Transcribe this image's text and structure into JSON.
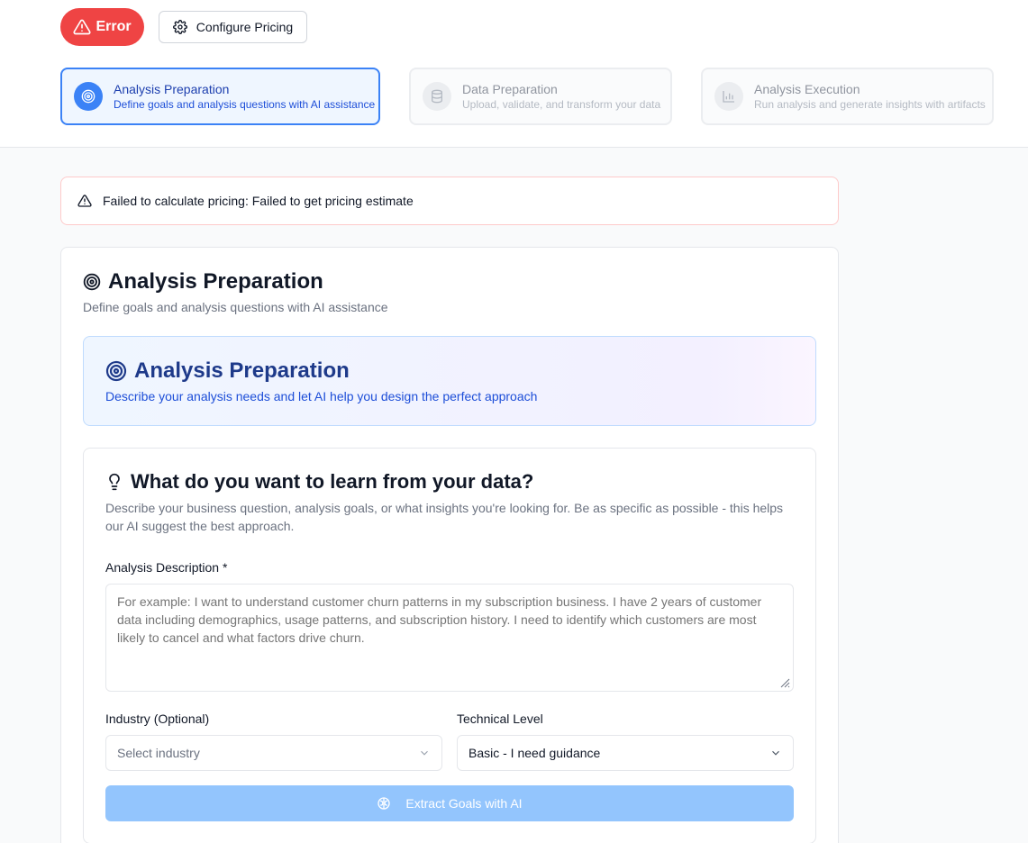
{
  "header": {
    "error_label": "Error",
    "configure_label": "Configure Pricing",
    "steps": [
      {
        "title": "Analysis Preparation",
        "subtitle": "Define goals and analysis questions with AI assistance",
        "state": "active"
      },
      {
        "title": "Data Preparation",
        "subtitle": "Upload, validate, and transform your data",
        "state": "inactive"
      },
      {
        "title": "Analysis Execution",
        "subtitle": "Run analysis and generate insights with artifacts",
        "state": "inactive"
      }
    ]
  },
  "alert": {
    "message": "Failed to calculate pricing: Failed to get pricing estimate"
  },
  "card": {
    "title": "Analysis Preparation",
    "subtitle": "Define goals and analysis questions with AI assistance",
    "banner": {
      "title": "Analysis Preparation",
      "subtitle": "Describe your analysis needs and let AI help you design the perfect approach"
    },
    "question": {
      "title": "What do you want to learn from your data?",
      "subtitle": "Describe your business question, analysis goals, or what insights you're looking for. Be as specific as possible - this helps our AI suggest the best approach."
    },
    "form": {
      "description_label": "Analysis Description *",
      "description_value": "",
      "description_placeholder": "For example: I want to understand customer churn patterns in my subscription business. I have 2 years of customer data including demographics, usage patterns, and subscription history. I need to identify which customers are most likely to cancel and what factors drive churn.",
      "industry_label": "Industry (Optional)",
      "industry_placeholder": "Select industry",
      "technical_label": "Technical Level",
      "technical_value": "Basic - I need guidance",
      "extract_label": "Extract Goals with AI"
    }
  },
  "colors": {
    "error": "#ef4444",
    "accent": "#3b82f6",
    "alert_border": "#fecaca",
    "button_disabled": "#93c5fd"
  },
  "icons": {
    "error": "alert-triangle-icon",
    "configure": "gear-icon",
    "step_active": "target-icon",
    "step_data": "database-icon",
    "step_execution": "bar-chart-icon",
    "alert": "alert-triangle-icon",
    "question": "lightbulb-icon",
    "extract": "brain-icon",
    "select": "chevron-down-icon"
  }
}
